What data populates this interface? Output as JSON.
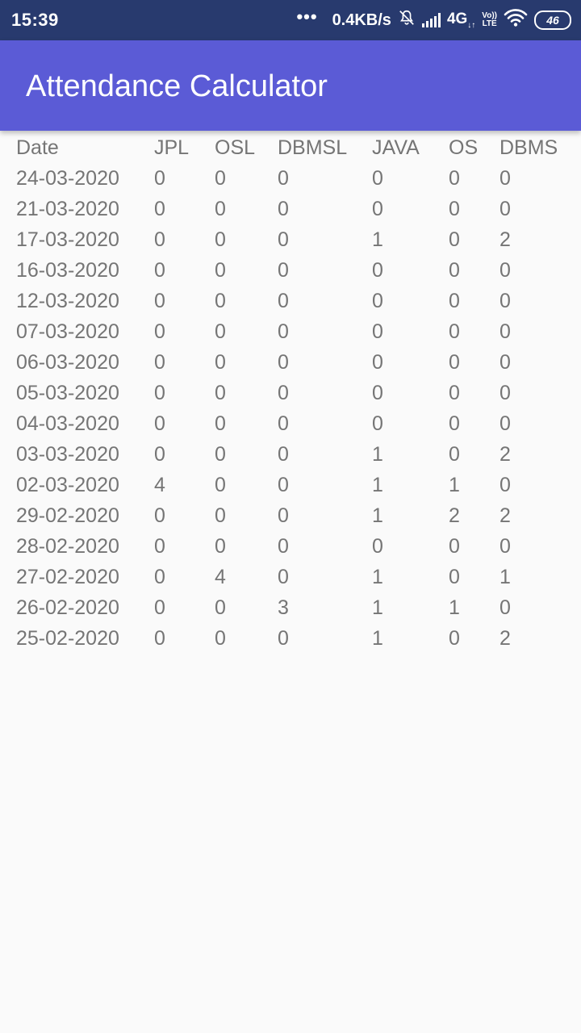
{
  "status_bar": {
    "time": "15:39",
    "dots": "•••",
    "net_speed": "0.4KB/s",
    "network": "4G",
    "volte_top": "Vo))",
    "volte_bottom": "LTE",
    "battery": "46",
    "icons": [
      "bell-off-icon",
      "signal-icon",
      "wifi-icon",
      "battery-icon"
    ]
  },
  "app_bar": {
    "title": "Attendance Calculator",
    "color": "#5b5bd6"
  },
  "table": {
    "headers": [
      "Date",
      "JPL",
      "OSL",
      "DBMSL",
      "JAVA",
      "OS",
      "DBMS"
    ],
    "rows": [
      [
        "24-03-2020",
        "0",
        "0",
        "0",
        "0",
        "0",
        "0"
      ],
      [
        "21-03-2020",
        "0",
        "0",
        "0",
        "0",
        "0",
        "0"
      ],
      [
        "17-03-2020",
        "0",
        "0",
        "0",
        "1",
        "0",
        "2"
      ],
      [
        "16-03-2020",
        "0",
        "0",
        "0",
        "0",
        "0",
        "0"
      ],
      [
        "12-03-2020",
        "0",
        "0",
        "0",
        "0",
        "0",
        "0"
      ],
      [
        "07-03-2020",
        "0",
        "0",
        "0",
        "0",
        "0",
        "0"
      ],
      [
        "06-03-2020",
        "0",
        "0",
        "0",
        "0",
        "0",
        "0"
      ],
      [
        "05-03-2020",
        "0",
        "0",
        "0",
        "0",
        "0",
        "0"
      ],
      [
        "04-03-2020",
        "0",
        "0",
        "0",
        "0",
        "0",
        "0"
      ],
      [
        "03-03-2020",
        "0",
        "0",
        "0",
        "1",
        "0",
        "2"
      ],
      [
        "02-03-2020",
        "4",
        "0",
        "0",
        "1",
        "1",
        "0"
      ],
      [
        "29-02-2020",
        "0",
        "0",
        "0",
        "1",
        "2",
        "2"
      ],
      [
        "28-02-2020",
        "0",
        "0",
        "0",
        "0",
        "0",
        "0"
      ],
      [
        "27-02-2020",
        "0",
        "4",
        "0",
        "1",
        "0",
        "1"
      ],
      [
        "26-02-2020",
        "0",
        "0",
        "3",
        "1",
        "1",
        "0"
      ],
      [
        "25-02-2020",
        "0",
        "0",
        "0",
        "1",
        "0",
        "2"
      ]
    ]
  }
}
